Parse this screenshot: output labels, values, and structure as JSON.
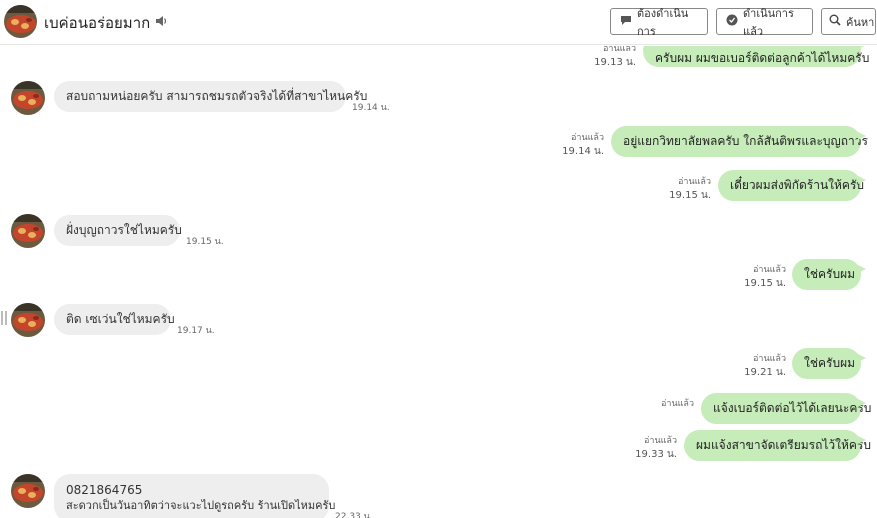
{
  "header": {
    "title": "เบค่อนอร่อยมาก",
    "buttons": {
      "todo": "ต้องดำเนินการ",
      "done": "ดำเนินการแล้ว",
      "search": "ค้นหา"
    }
  },
  "colors": {
    "outgoing": "#c6ecb9",
    "incoming": "#eeeeee"
  },
  "messages": {
    "m0": {
      "text": "ครับผม ผมขอเบอร์ติดต่อลูกค้าได้ไหมครับ",
      "read": "อ่านแล้ว",
      "time": "19.13 น."
    },
    "m1": {
      "text": "สอบถามหน่อยครับ สามารถชมรถตัวจริงได้ที่สาขาไหนครับ",
      "time": "19.14 น."
    },
    "m2": {
      "text": "อยู่แยกวิทยาลัยพลครับ ใกล้สันติพรและบุญถาวร",
      "read": "อ่านแล้ว",
      "time": "19.14 น."
    },
    "m3": {
      "text": "เดี๋ยวผมส่งพิกัดร้านให้ครับ",
      "read": "อ่านแล้ว",
      "time": "19.15 น."
    },
    "m4": {
      "text": "ฝั่งบุญถาวรใช่ไหมครับ",
      "time": "19.15 น."
    },
    "m5": {
      "text": "ใช่ครับผม",
      "read": "อ่านแล้ว",
      "time": "19.15 น."
    },
    "m6": {
      "text": "ติด เซเว่นใช่ไหมครับ",
      "time": "19.17 น."
    },
    "m7": {
      "text": "ใช่ครับผม",
      "read": "อ่านแล้ว",
      "time": "19.21 น."
    },
    "m8": {
      "text": "แจ้งเบอร์ติดต่อไว้ได้เลยนะครับ",
      "read": "อ่านแล้ว"
    },
    "m9": {
      "text": "ผมแจ้งสาขาจัดเตรียมรถไว้ให้ครับ",
      "read": "อ่านแล้ว",
      "time": "19.33 น."
    },
    "m10": {
      "line1": "0821864765",
      "line2": "สะดวกเป็นวันอาทิตว่าจะแวะไปดูรถครับ ร้านเปิดไหมครับ",
      "time": "22.33 น."
    }
  }
}
